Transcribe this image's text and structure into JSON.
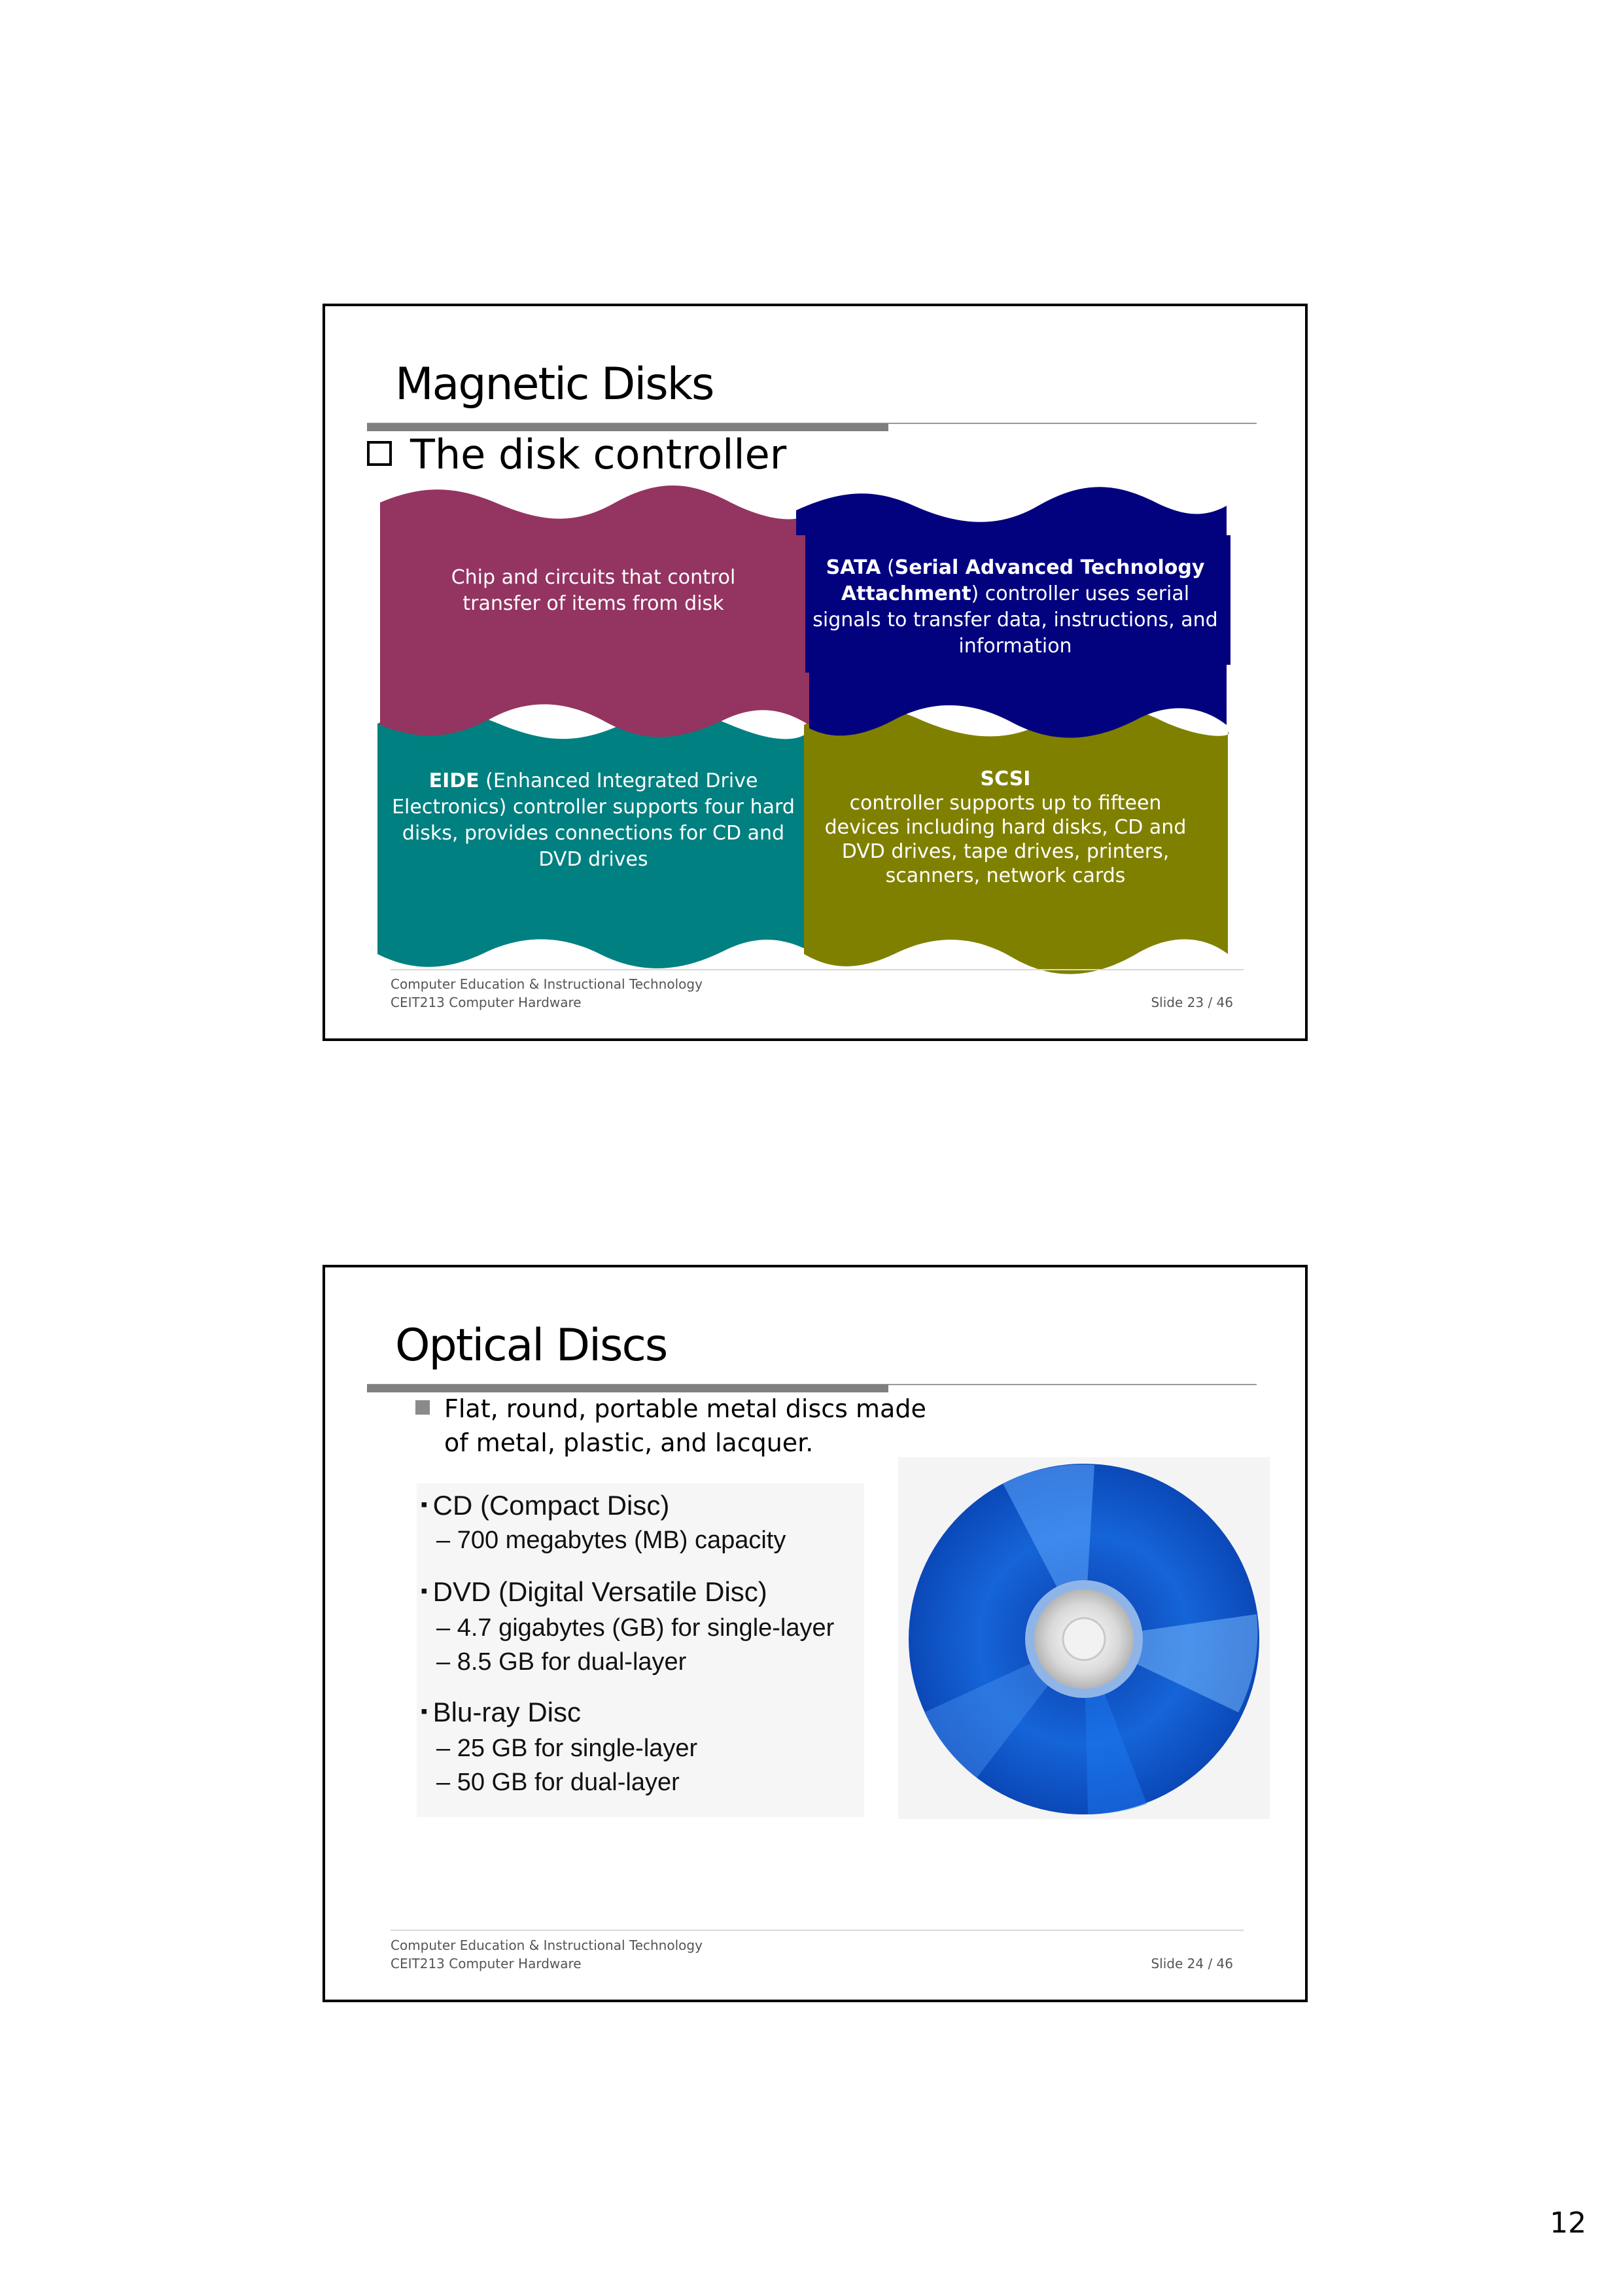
{
  "page_number": "12",
  "slide1": {
    "title": "Magnetic Disks",
    "subtitle": "The disk controller",
    "boxes": {
      "chip": "Chip and circuits that control transfer of items from disk",
      "sata_bold1": "SATA",
      "sata_paren": " (",
      "sata_bold2": "Serial Advanced Technology Attachment",
      "sata_rest": ") controller uses serial signals to transfer data, instructions, and information",
      "eide_bold": "EIDE",
      "eide_text": " (Enhanced Integrated Drive Electronics) controller supports four hard disks, provides connections for CD and DVD drives",
      "scsi_bold": "SCSI",
      "scsi_text": "controller supports up to fifteen devices including hard disks, CD and DVD drives, tape drives, printers, scanners, network cards"
    },
    "footer_line1": "Computer Education & Instructional Technology",
    "footer_line2": "CEIT213 Computer Hardware",
    "slide_num": "Slide 23 / 46",
    "colors": {
      "chip": "#943461",
      "sata": "#02027f",
      "eide": "#008080",
      "scsi": "#808000"
    }
  },
  "slide2": {
    "title": "Optical Discs",
    "bullet_line1": "Flat, round, portable metal discs made",
    "bullet_line2": "of metal, plastic, and lacquer.",
    "list": {
      "cd": "CD (Compact Disc)",
      "cd_cap": "700 megabytes (MB) capacity",
      "dvd": "DVD (Digital Versatile Disc)",
      "dvd_single": "4.7 gigabytes (GB) for single-layer",
      "dvd_dual": "8.5 GB for dual-layer",
      "bluray": "Blu-ray Disc",
      "bluray_single": "25 GB for single-layer",
      "bluray_dual": "50 GB for dual-layer"
    },
    "footer_line1": "Computer Education & Instructional Technology",
    "footer_line2": "CEIT213 Computer Hardware",
    "slide_num": "Slide 24 / 46",
    "disc_icon": "optical-disc-icon",
    "disc_color": "#1565d8"
  }
}
